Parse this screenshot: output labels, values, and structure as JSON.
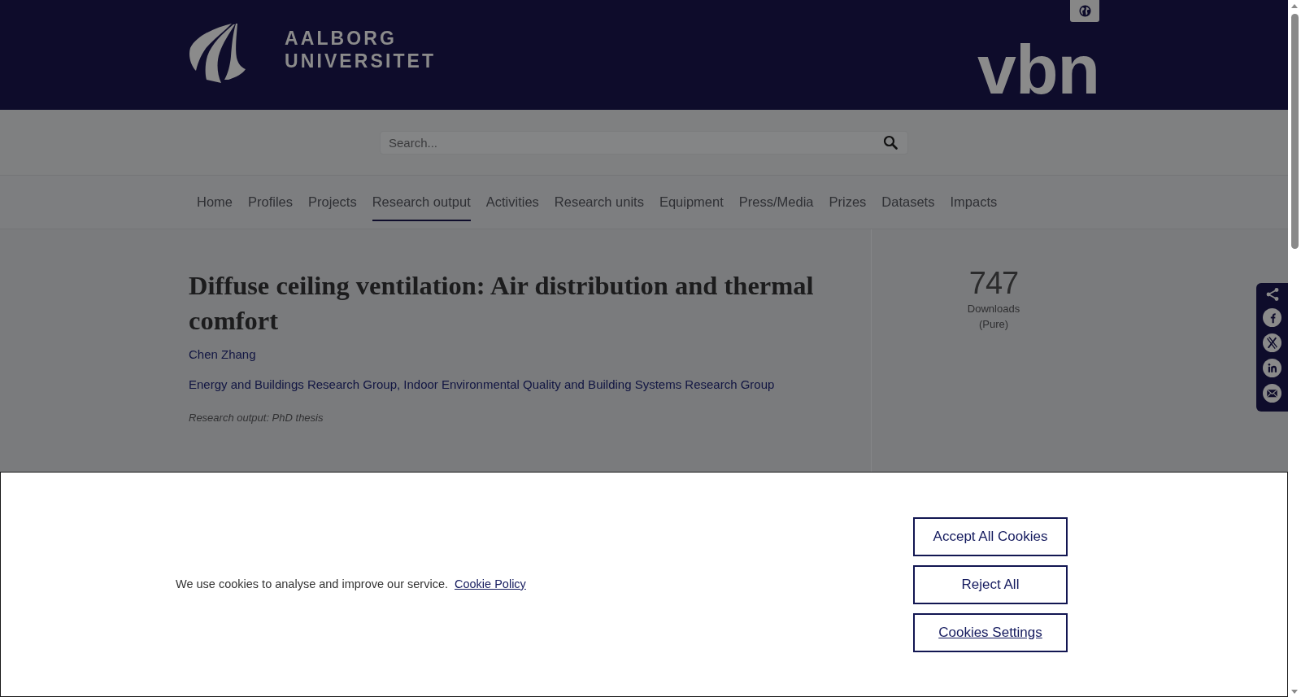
{
  "header": {
    "university_wordmark": "AALBORG UNIVERSITET",
    "library_wordmark": "vbn"
  },
  "search": {
    "placeholder": "Search..."
  },
  "navigation": [
    {
      "label": "Home",
      "selected": false
    },
    {
      "label": "Profiles",
      "selected": false
    },
    {
      "label": "Projects",
      "selected": false
    },
    {
      "label": "Research output",
      "selected": true
    },
    {
      "label": "Activities",
      "selected": false
    },
    {
      "label": "Research units",
      "selected": false
    },
    {
      "label": "Equipment",
      "selected": false
    },
    {
      "label": "Press/Media",
      "selected": false
    },
    {
      "label": "Prizes",
      "selected": false
    },
    {
      "label": "Datasets",
      "selected": false
    },
    {
      "label": "Impacts",
      "selected": false
    }
  ],
  "publication": {
    "title": "Diffuse ceiling ventilation: Air distribution and thermal comfort",
    "author": "Chen Zhang",
    "organisations": [
      "Energy and Buildings Research Group",
      "Indoor Environmental Quality and Building Systems Research Group"
    ],
    "organisation_separator": ", ",
    "output_type": "Research output: PhD thesis"
  },
  "metrics": {
    "downloads": "747",
    "downloads_label": "Downloads (Pure)"
  },
  "cookie_banner": {
    "message": "We use cookies to analyse and improve our service.",
    "policy_link": "Cookie Policy",
    "buttons": [
      {
        "label": "Accept All Cookies",
        "kind": "button"
      },
      {
        "label": "Reject All",
        "kind": "button"
      },
      {
        "label": "Cookies Settings",
        "kind": "link"
      }
    ]
  }
}
